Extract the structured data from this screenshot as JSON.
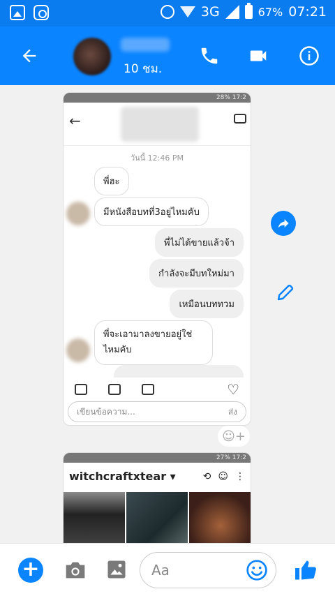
{
  "status_bar": {
    "network": "3G",
    "battery": "67%",
    "time": "07:21",
    "icons": [
      "gallery-icon",
      "instagram-icon",
      "alarm-icon",
      "wifi-icon",
      "signal-icon",
      "battery-icon"
    ]
  },
  "header": {
    "contact_status": "10 ชม.",
    "icons": [
      "back-arrow-icon",
      "phone-icon",
      "video-camera-icon",
      "info-icon"
    ]
  },
  "screenshot1": {
    "status_text": "28% 17:2",
    "date": "วันนี้ 12:46 PM",
    "messages": [
      {
        "dir": "in",
        "text": "พี่ฮะ"
      },
      {
        "dir": "in",
        "text": "มีหนังสือบทที่3อยู่ไหมคับ"
      },
      {
        "dir": "out",
        "text": "พี่ไม่ได้ขายแล้วจ้า"
      },
      {
        "dir": "out",
        "text": "กำลังจะมีบทใหม่มา"
      },
      {
        "dir": "out",
        "text": "เหมือนบททวม"
      },
      {
        "dir": "in",
        "text": "พี่จะเอามาลงขายอยู่ใช่"
      },
      {
        "dir": "in",
        "text": "ไหมคับ"
      }
    ],
    "input_placeholder": "เขียนข้อความ...",
    "send_label": "ส่ง"
  },
  "screenshot2": {
    "status_text": "27% 17:2",
    "profile_name": "witchcraftxtear"
  },
  "composer": {
    "placeholder": "Aa"
  },
  "colors": {
    "brand_blue": "#0a84ff",
    "status_blue": "#0a7cf0"
  }
}
